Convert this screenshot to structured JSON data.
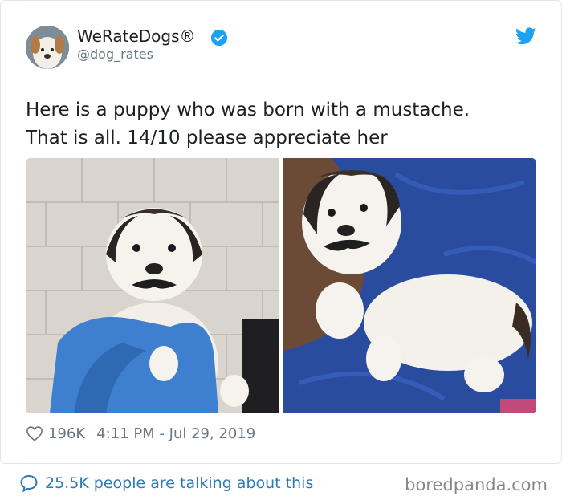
{
  "author": {
    "name": "WeRateDogs®",
    "handle": "@dog_rates",
    "verified": true,
    "avatar_icon": "dog-avatar-icon"
  },
  "tweet": {
    "text": "Here is a puppy who was born with a mustache.\nThat is all. 14/10 please appreciate her",
    "photos": [
      {
        "icon": "puppy-photo-held-in-gloved-hands"
      },
      {
        "icon": "puppy-photo-on-blue-blanket"
      }
    ]
  },
  "meta": {
    "likes": "196K",
    "timestamp": "4:11 PM - Jul 29, 2019"
  },
  "footer": {
    "conversation": "25.5K people are talking about this",
    "credit": "boredpanda.com"
  },
  "colors": {
    "link": "#2b7bb9",
    "verified": "#1da1f2",
    "twitter_blue": "#1da1f2",
    "muted": "#697882"
  }
}
